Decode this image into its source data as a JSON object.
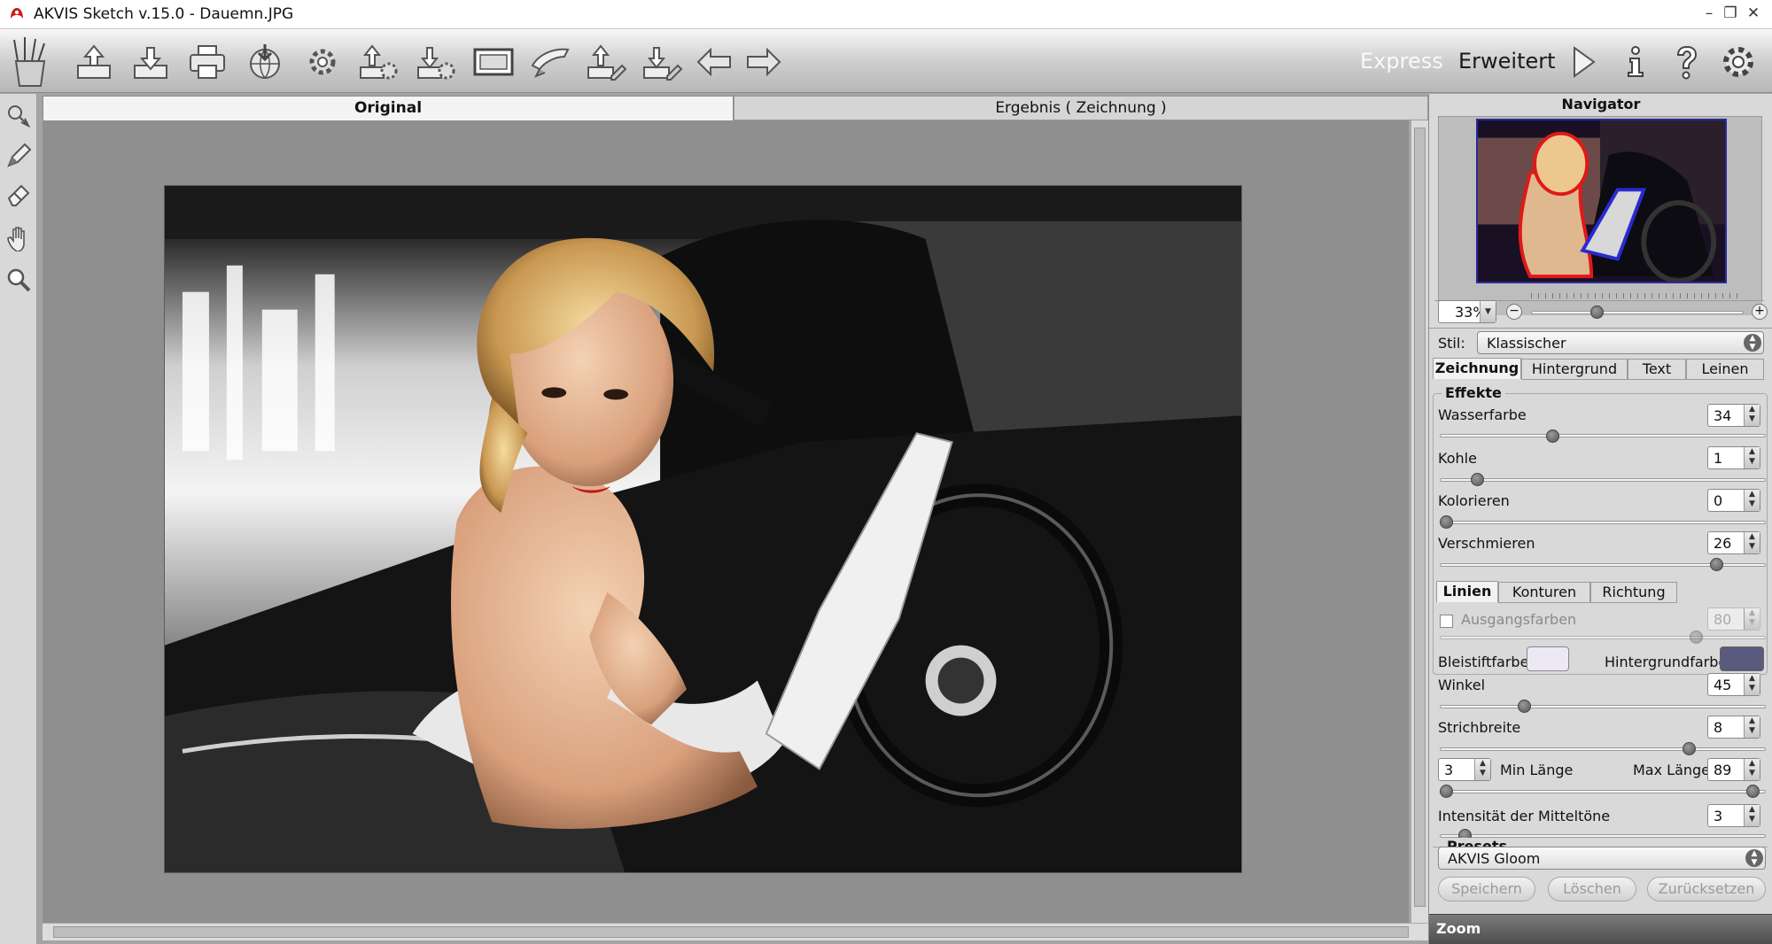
{
  "window": {
    "title": "AKVIS Sketch v.15.0 - Dauemn.JPG",
    "minimize_glyph": "–",
    "maximize_glyph": "❐",
    "close_glyph": "✕"
  },
  "toolbar": {
    "left_icons": [
      "sketch-pencils-icon",
      "open-image-icon",
      "save-image-icon",
      "print-icon",
      "share-globe-icon",
      "settings-gear-icon",
      "load-settings-icon",
      "save-settings-icon",
      "batch-film-icon",
      "brush-settings-icon",
      "import-strokes-icon",
      "export-strokes-icon",
      "undo-arrow-icon",
      "redo-arrow-icon"
    ],
    "mode_express": "Express",
    "mode_erweitert": "Erweitert",
    "right_icons": [
      "run-play-icon",
      "info-icon",
      "help-icon",
      "preferences-gear-icon"
    ]
  },
  "left_tools": [
    "direction-tool-icon",
    "stroke-pencil-icon",
    "eraser-icon",
    "hand-tool-icon",
    "zoom-tool-icon"
  ],
  "tabs": {
    "original": "Original",
    "ergebnis": "Ergebnis ( Zeichnung )"
  },
  "navigator": {
    "title": "Navigator",
    "zoom": "33%",
    "zoom_level": 0.3
  },
  "settings": {
    "stil_label": "Stil:",
    "stil_value": "Klassischer",
    "tabs": [
      "Zeichnung",
      "Hintergrund",
      "Text",
      "Leinen"
    ],
    "effekte": {
      "title": "Effekte",
      "wasserfarbe": {
        "label": "Wasserfarbe",
        "value": "34"
      },
      "kohle": {
        "label": "Kohle",
        "value": "1"
      },
      "kolorieren": {
        "label": "Kolorieren",
        "value": "0"
      },
      "verschmieren": {
        "label": "Verschmieren",
        "value": "26"
      }
    },
    "linien_tabs": [
      "Linien",
      "Konturen",
      "Richtung"
    ],
    "linien": {
      "ausgangsfarben": {
        "label": "Ausgangsfarben",
        "value": "80"
      },
      "bleistiftfarbe": "Bleistiftfarbe",
      "bleistiftfarbe_color": "#ece9f5",
      "hintergrundfarbe": "Hintergrundfarbe",
      "hintergrundfarbe_color": "#5a5a7e",
      "winkel": {
        "label": "Winkel",
        "value": "45"
      },
      "strichbreite": {
        "label": "Strichbreite",
        "value": "8"
      },
      "min_laenge": {
        "label": "Min Länge",
        "value": "3"
      },
      "max_laenge": {
        "label": "Max Länge",
        "value": "89"
      },
      "mitteltoene": {
        "label": "Intensität der Mitteltöne",
        "value": "3"
      }
    }
  },
  "presets": {
    "title": "Presets",
    "value": "AKVIS Gloom",
    "speichern": "Speichern",
    "loeschen": "Löschen",
    "zuruecksetzen": "Zurücksetzen"
  },
  "zoom_bar": {
    "label": "Zoom"
  }
}
